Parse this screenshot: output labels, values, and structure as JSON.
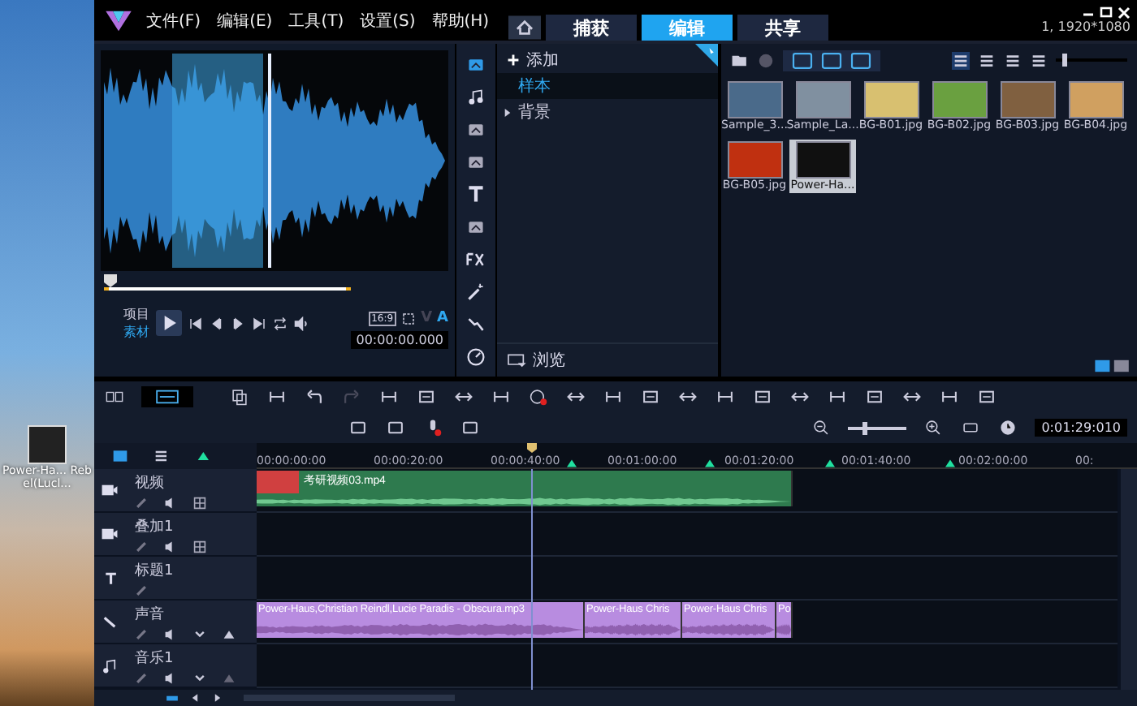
{
  "desktop_icon": {
    "label": "Power-Ha... Rebel(Lucl..."
  },
  "menu": [
    "文件(F)",
    "编辑(E)",
    "工具(T)",
    "设置(S)",
    "帮助(H)"
  ],
  "tabs": [
    {
      "label": "捕获",
      "selected": false
    },
    {
      "label": "编辑",
      "selected": true
    },
    {
      "label": "共享",
      "selected": false
    }
  ],
  "resolution": "1, 1920*1080",
  "player": {
    "modes": [
      {
        "label": "项目",
        "selected": false
      },
      {
        "label": "素材",
        "selected": true
      }
    ],
    "aspect": "16:9",
    "tracks": [
      {
        "label": "V",
        "selected": false
      },
      {
        "label": "A",
        "selected": true
      }
    ],
    "timecode": "00:00:00.000"
  },
  "library": {
    "thumbnail_size": {
      "level": 0.1
    },
    "add_label": "添加",
    "folders": [
      {
        "label": "样本",
        "selected": true,
        "expandable": false
      },
      {
        "label": "背景",
        "selected": false,
        "expandable": true
      }
    ],
    "browse": "浏览",
    "media": [
      {
        "name": "Sample_3...",
        "selected": false
      },
      {
        "name": "Sample_La...",
        "selected": false
      },
      {
        "name": "BG-B01.jpg",
        "selected": false
      },
      {
        "name": "BG-B02.jpg",
        "selected": false
      },
      {
        "name": "BG-B03.jpg",
        "selected": false
      },
      {
        "name": "BG-B04.jpg",
        "selected": false
      },
      {
        "name": "BG-B05.jpg",
        "selected": false
      },
      {
        "name": "Power-Ha...",
        "selected": true
      }
    ]
  },
  "timeline": {
    "timecode": "0:01:29:010",
    "ruler": [
      "00:00:00:00",
      "00:00:20:00",
      "00:00:40:00",
      "00:01:00:00",
      "00:01:20:00",
      "00:01:40:00",
      "00:02:00:00",
      "00:"
    ],
    "tracks": [
      {
        "name": "视频",
        "kind": "video",
        "clips": [
          {
            "label": "考研视频03.mp4"
          }
        ]
      },
      {
        "name": "叠加1",
        "kind": "overlay"
      },
      {
        "name": "标题1",
        "kind": "title"
      },
      {
        "name": "声音",
        "kind": "voice",
        "clips": [
          {
            "label": "Power-Haus,Christian Reindl,Lucie Paradis - Obscura.mp3"
          },
          {
            "label": "Power-Haus Chris"
          },
          {
            "label": "Power-Haus Chris"
          },
          {
            "label": "Po"
          }
        ]
      },
      {
        "name": "音乐1",
        "kind": "music"
      }
    ],
    "zoom": {
      "level": 0.25
    }
  }
}
